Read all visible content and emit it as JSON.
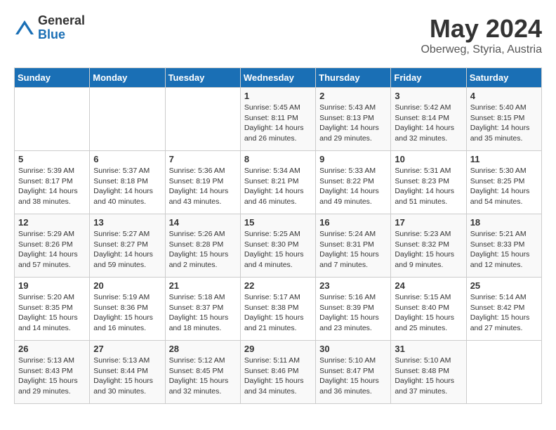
{
  "logo": {
    "general": "General",
    "blue": "Blue"
  },
  "title": "May 2024",
  "subtitle": "Oberweg, Styria, Austria",
  "days_of_week": [
    "Sunday",
    "Monday",
    "Tuesday",
    "Wednesday",
    "Thursday",
    "Friday",
    "Saturday"
  ],
  "weeks": [
    [
      {
        "day": "",
        "info": ""
      },
      {
        "day": "",
        "info": ""
      },
      {
        "day": "",
        "info": ""
      },
      {
        "day": "1",
        "info": "Sunrise: 5:45 AM\nSunset: 8:11 PM\nDaylight: 14 hours and 26 minutes."
      },
      {
        "day": "2",
        "info": "Sunrise: 5:43 AM\nSunset: 8:13 PM\nDaylight: 14 hours and 29 minutes."
      },
      {
        "day": "3",
        "info": "Sunrise: 5:42 AM\nSunset: 8:14 PM\nDaylight: 14 hours and 32 minutes."
      },
      {
        "day": "4",
        "info": "Sunrise: 5:40 AM\nSunset: 8:15 PM\nDaylight: 14 hours and 35 minutes."
      }
    ],
    [
      {
        "day": "5",
        "info": "Sunrise: 5:39 AM\nSunset: 8:17 PM\nDaylight: 14 hours and 38 minutes."
      },
      {
        "day": "6",
        "info": "Sunrise: 5:37 AM\nSunset: 8:18 PM\nDaylight: 14 hours and 40 minutes."
      },
      {
        "day": "7",
        "info": "Sunrise: 5:36 AM\nSunset: 8:19 PM\nDaylight: 14 hours and 43 minutes."
      },
      {
        "day": "8",
        "info": "Sunrise: 5:34 AM\nSunset: 8:21 PM\nDaylight: 14 hours and 46 minutes."
      },
      {
        "day": "9",
        "info": "Sunrise: 5:33 AM\nSunset: 8:22 PM\nDaylight: 14 hours and 49 minutes."
      },
      {
        "day": "10",
        "info": "Sunrise: 5:31 AM\nSunset: 8:23 PM\nDaylight: 14 hours and 51 minutes."
      },
      {
        "day": "11",
        "info": "Sunrise: 5:30 AM\nSunset: 8:25 PM\nDaylight: 14 hours and 54 minutes."
      }
    ],
    [
      {
        "day": "12",
        "info": "Sunrise: 5:29 AM\nSunset: 8:26 PM\nDaylight: 14 hours and 57 minutes."
      },
      {
        "day": "13",
        "info": "Sunrise: 5:27 AM\nSunset: 8:27 PM\nDaylight: 14 hours and 59 minutes."
      },
      {
        "day": "14",
        "info": "Sunrise: 5:26 AM\nSunset: 8:28 PM\nDaylight: 15 hours and 2 minutes."
      },
      {
        "day": "15",
        "info": "Sunrise: 5:25 AM\nSunset: 8:30 PM\nDaylight: 15 hours and 4 minutes."
      },
      {
        "day": "16",
        "info": "Sunrise: 5:24 AM\nSunset: 8:31 PM\nDaylight: 15 hours and 7 minutes."
      },
      {
        "day": "17",
        "info": "Sunrise: 5:23 AM\nSunset: 8:32 PM\nDaylight: 15 hours and 9 minutes."
      },
      {
        "day": "18",
        "info": "Sunrise: 5:21 AM\nSunset: 8:33 PM\nDaylight: 15 hours and 12 minutes."
      }
    ],
    [
      {
        "day": "19",
        "info": "Sunrise: 5:20 AM\nSunset: 8:35 PM\nDaylight: 15 hours and 14 minutes."
      },
      {
        "day": "20",
        "info": "Sunrise: 5:19 AM\nSunset: 8:36 PM\nDaylight: 15 hours and 16 minutes."
      },
      {
        "day": "21",
        "info": "Sunrise: 5:18 AM\nSunset: 8:37 PM\nDaylight: 15 hours and 18 minutes."
      },
      {
        "day": "22",
        "info": "Sunrise: 5:17 AM\nSunset: 8:38 PM\nDaylight: 15 hours and 21 minutes."
      },
      {
        "day": "23",
        "info": "Sunrise: 5:16 AM\nSunset: 8:39 PM\nDaylight: 15 hours and 23 minutes."
      },
      {
        "day": "24",
        "info": "Sunrise: 5:15 AM\nSunset: 8:40 PM\nDaylight: 15 hours and 25 minutes."
      },
      {
        "day": "25",
        "info": "Sunrise: 5:14 AM\nSunset: 8:42 PM\nDaylight: 15 hours and 27 minutes."
      }
    ],
    [
      {
        "day": "26",
        "info": "Sunrise: 5:13 AM\nSunset: 8:43 PM\nDaylight: 15 hours and 29 minutes."
      },
      {
        "day": "27",
        "info": "Sunrise: 5:13 AM\nSunset: 8:44 PM\nDaylight: 15 hours and 30 minutes."
      },
      {
        "day": "28",
        "info": "Sunrise: 5:12 AM\nSunset: 8:45 PM\nDaylight: 15 hours and 32 minutes."
      },
      {
        "day": "29",
        "info": "Sunrise: 5:11 AM\nSunset: 8:46 PM\nDaylight: 15 hours and 34 minutes."
      },
      {
        "day": "30",
        "info": "Sunrise: 5:10 AM\nSunset: 8:47 PM\nDaylight: 15 hours and 36 minutes."
      },
      {
        "day": "31",
        "info": "Sunrise: 5:10 AM\nSunset: 8:48 PM\nDaylight: 15 hours and 37 minutes."
      },
      {
        "day": "",
        "info": ""
      }
    ]
  ]
}
